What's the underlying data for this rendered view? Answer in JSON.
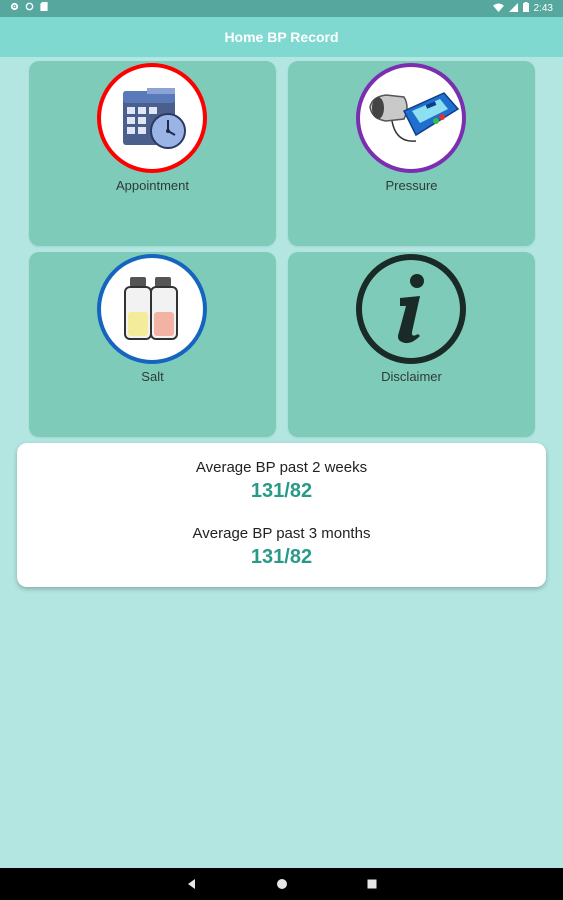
{
  "status_bar": {
    "time": "2:43",
    "icons": [
      "gear-icon",
      "circle-icon",
      "sd-card-icon",
      "wifi-icon",
      "signal-icon",
      "battery-icon"
    ]
  },
  "app_bar": {
    "title": "Home BP Record"
  },
  "tiles": [
    {
      "label": "Appointment",
      "icon": "calendar-clock-icon",
      "ring_color": "#ff0000"
    },
    {
      "label": "Pressure",
      "icon": "bp-monitor-icon",
      "ring_color": "#7b2fb0"
    },
    {
      "label": "Salt",
      "icon": "salt-shakers-icon",
      "ring_color": "#1565c0"
    },
    {
      "label": "Disclaimer",
      "icon": "info-icon",
      "ring_color": "#1a2a26"
    }
  ],
  "averages": {
    "two_weeks_label": "Average BP past 2 weeks",
    "two_weeks_value": "131/82",
    "three_months_label": "Average BP past 3 months",
    "three_months_value": "131/82"
  },
  "nav_bar": {
    "icons": [
      "back-icon",
      "home-icon",
      "recents-icon"
    ]
  },
  "colors": {
    "background": "#b3e6e1",
    "app_bar": "#80d9d1",
    "tile": "#7fcbb9",
    "accent_value": "#2a9a88"
  }
}
